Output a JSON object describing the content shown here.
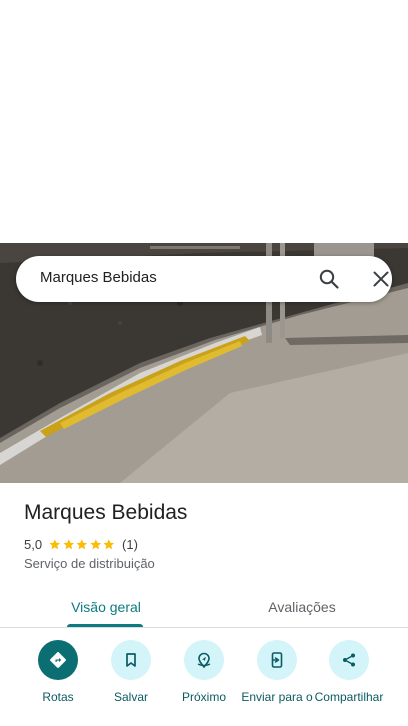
{
  "search": {
    "query": "Marques Bebidas"
  },
  "place": {
    "name": "Marques Bebidas",
    "rating": "5,0",
    "stars": 5,
    "review_count": "(1)",
    "category": "Serviço de distribuição"
  },
  "tabs": [
    {
      "label": "Visão geral",
      "active": true
    },
    {
      "label": "Avaliações",
      "active": false
    }
  ],
  "actions": [
    {
      "label": "Rotas",
      "icon": "directions-icon"
    },
    {
      "label": "Salvar",
      "icon": "bookmark-icon"
    },
    {
      "label": "Próximo",
      "icon": "nearby-icon"
    },
    {
      "label": "Enviar para o",
      "icon": "send-to-phone-icon"
    },
    {
      "label": "Compartilhar",
      "icon": "share-icon"
    }
  ],
  "colors": {
    "accent": "#0b7b81",
    "action_bg": "#d3f4f9",
    "primary_action_bg": "#0b6e72",
    "star": "#fbbc04"
  }
}
